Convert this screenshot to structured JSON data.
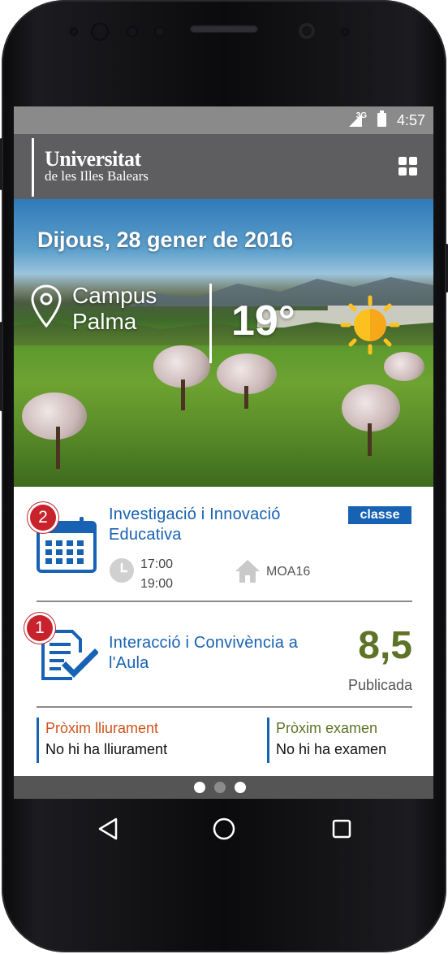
{
  "status_bar": {
    "network": "3G",
    "time": "4:57"
  },
  "app_bar": {
    "logo_title": "Universitat",
    "logo_subtitle": "de les Illes Balears",
    "menu_icon": "grid-icon"
  },
  "hero": {
    "date": "Dijous, 28 gener de 2016",
    "campus_line1": "Campus",
    "campus_line2": "Palma",
    "temperature": "19°",
    "weather_icon": "sun-icon"
  },
  "class_card": {
    "badge": "2",
    "title_line1": "Investigació i Innovació",
    "title_line2": "Educativa",
    "tag": "classe",
    "start_time": "17:00",
    "end_time": "19:00",
    "room": "MOA16"
  },
  "grade_card": {
    "badge": "1",
    "title_line1": "Interacció i Convivència a",
    "title_line2": "l'Aula",
    "grade": "8,5",
    "grade_status": "Publicada"
  },
  "next_delivery": {
    "label": "Pròxim lliurament",
    "value": "No hi ha lliurament",
    "color": "#d0521b"
  },
  "next_exam": {
    "label": "Pròxim examen",
    "value": "No hi ha examen",
    "color": "#5f7327"
  },
  "pager": {
    "pages": 3,
    "active_index": 1
  },
  "colors": {
    "accent_blue": "#1762b3",
    "badge_red": "#c8232c",
    "grade_green": "#5f7327",
    "app_bar": "#5e5e60"
  }
}
